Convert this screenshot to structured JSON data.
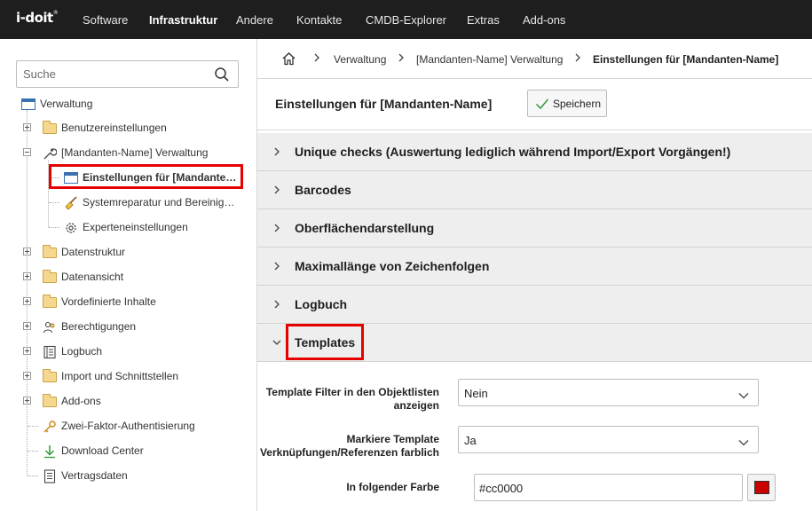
{
  "app": {
    "logo": "i-doit",
    "logo_mark": "®"
  },
  "topnav": [
    {
      "label": "Software",
      "active": false
    },
    {
      "label": "Infrastruktur",
      "active": true
    },
    {
      "label": "Andere",
      "active": false
    },
    {
      "label": "Kontakte",
      "active": false
    },
    {
      "label": "CMDB-Explorer",
      "active": false
    },
    {
      "label": "Extras",
      "active": false
    },
    {
      "label": "Add-ons",
      "active": false
    }
  ],
  "sidebar": {
    "search_placeholder": "Suche",
    "root": "Verwaltung",
    "items": [
      {
        "label": "Benutzereinstellungen",
        "icon": "folder-icon"
      },
      {
        "label": "[Mandanten-Name] Verwaltung",
        "icon": "wrench-icon",
        "children": [
          {
            "label": "Einstellungen für [Mandante…",
            "icon": "window-icon",
            "selected": true
          },
          {
            "label": "Systemreparatur und Bereinig…",
            "icon": "broom-icon"
          },
          {
            "label": "Experteneinstellungen",
            "icon": "gear-icon"
          }
        ]
      },
      {
        "label": "Datenstruktur",
        "icon": "folder-icon"
      },
      {
        "label": "Datenansicht",
        "icon": "folder-icon"
      },
      {
        "label": "Vordefinierte Inhalte",
        "icon": "folder-icon"
      },
      {
        "label": "Berechtigungen",
        "icon": "users-icon"
      },
      {
        "label": "Logbuch",
        "icon": "logbook-icon"
      },
      {
        "label": "Import und Schnittstellen",
        "icon": "folder-icon"
      },
      {
        "label": "Add-ons",
        "icon": "folder-icon"
      },
      {
        "label": "Zwei-Faktor-Authentisierung",
        "icon": "key-icon"
      },
      {
        "label": "Download Center",
        "icon": "download-icon"
      },
      {
        "label": "Vertragsdaten",
        "icon": "document-icon"
      }
    ]
  },
  "breadcrumb": {
    "items": [
      "Verwaltung",
      "[Mandanten-Name] Verwaltung",
      "Einstellungen für [Mandanten-Name]"
    ]
  },
  "header": {
    "title": "Einstellungen für [Mandanten-Name]",
    "save_label": "Speichern"
  },
  "sections": [
    {
      "title": "Unique checks (Auswertung lediglich während Import/Export Vorgängen!)",
      "expanded": false
    },
    {
      "title": "Barcodes",
      "expanded": false
    },
    {
      "title": "Oberflächendarstellung",
      "expanded": false
    },
    {
      "title": "Maximallänge von Zeichenfolgen",
      "expanded": false
    },
    {
      "title": "Logbuch",
      "expanded": false
    },
    {
      "title": "Templates",
      "expanded": true
    }
  ],
  "templates_form": {
    "filter_label_1": "Template Filter in den Objektlisten",
    "filter_label_2": "anzeigen",
    "filter_value": "Nein",
    "mark_label_1": "Markiere Template",
    "mark_label_2": "Verknüpfungen/Referenzen farblich",
    "mark_value": "Ja",
    "color_label": "In folgender Farbe",
    "color_value": "#cc0000"
  },
  "colors": {
    "highlight": "#e60000",
    "swatch": "#cc0000",
    "topbar": "#1e1e1e"
  }
}
